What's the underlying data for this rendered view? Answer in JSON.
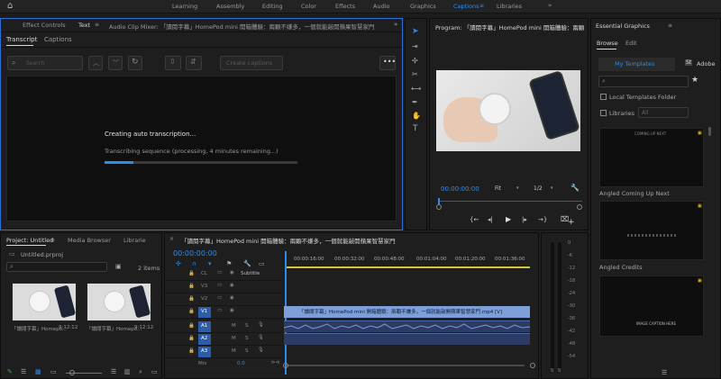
{
  "workspaces": [
    "Learning",
    "Assembly",
    "Editing",
    "Color",
    "Effects",
    "Audio",
    "Graphics",
    "Captions",
    "Libraries"
  ],
  "active_workspace": "Captions",
  "left_panel": {
    "tabs": [
      "Effect Controls",
      "Text",
      "Audio Clip Mixer: 「讀閱字幕」HomePod mini 開箱體驗：兩顆不嫌多，一個就能敲開蘋果智慧家門"
    ],
    "subtabs": [
      "Transcript",
      "Captions"
    ],
    "search_placeholder": "Search",
    "create_captions": "Create captions",
    "status_title": "Creating auto transcription...",
    "status_detail": "Transcribing sequence (processing, 4 minutes remaining...)",
    "progress": 0.15
  },
  "tools": [
    "selection",
    "track-select",
    "ripple-edit",
    "razor",
    "slip",
    "pen",
    "hand",
    "type"
  ],
  "program": {
    "title": "Program: 「讀閱字幕」HomePod mini 開箱體驗：兩顆",
    "timecode": "00:00:00:00",
    "fit": "Fit",
    "resolution": "1/2"
  },
  "essential_graphics": {
    "title": "Essential Graphics",
    "tabs": [
      "Browse",
      "Edit"
    ],
    "templates_tab": "My Templates",
    "adobe_tab": "Adobe",
    "local_folder": "Local Templates Folder",
    "libraries": "Libraries",
    "library_value": "All",
    "items": [
      "Angled Coming Up Next",
      "Angled Credits"
    ],
    "thumb_texts": [
      "COMING UP NEXT",
      "",
      "IMAGE CAPTION HERE"
    ]
  },
  "project": {
    "tabs": [
      "Project: Untitled",
      "Media Browser",
      "Librarie"
    ],
    "file": "Untitled.prproj",
    "items_count": "2 items",
    "clips": [
      {
        "name": "「讀閱字幕」Homepo...",
        "duration": "9:12:12"
      },
      {
        "name": "「讀閱字幕」Homepo...",
        "duration": "9:12:12"
      }
    ]
  },
  "timeline": {
    "title": "「讀閱字幕」HomePod mini 開箱體驗：兩顆不嫌多，一個就能敲開蘋果智慧家門",
    "timecode": "00:00:00:00",
    "ruler": [
      "00:00:16:00",
      "00:00:32:00",
      "00:00:48:00",
      "00:01:04:00",
      "00:01:20:00",
      "00:01:36:00"
    ],
    "tracks": [
      "CL",
      "V3",
      "V2",
      "V1",
      "A1",
      "A2",
      "A3"
    ],
    "subtitle_label": "Subtitle",
    "clip_name": "「讀閱字幕」HomePod mini 開箱體驗：兩顆不嫌多，一個就能敲開蘋果智慧家門.mp4 [V]",
    "mix_label": "Mix",
    "mix_value": "0.0"
  },
  "meter_labels": [
    "0",
    "-6",
    "-12",
    "-18",
    "-24",
    "-30",
    "-36",
    "-42",
    "-48",
    "-54"
  ],
  "meter_footer": [
    "S",
    "S"
  ],
  "colors": {
    "accent": "#2d8ceb",
    "clip": "#7c9fd9",
    "audio": "#2b3b63"
  }
}
